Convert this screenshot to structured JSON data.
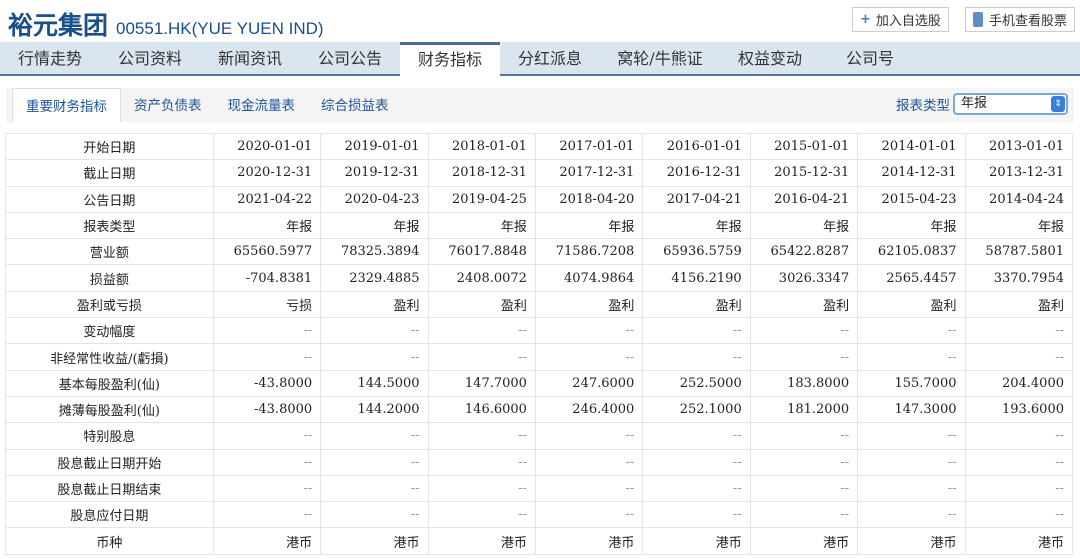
{
  "header": {
    "name": "裕元集团",
    "code": "00551.HK(YUE YUEN IND)",
    "add_watch": "加入自选股",
    "mobile_view": "手机查看股票"
  },
  "nav": [
    "行情走势",
    "公司资料",
    "新闻资讯",
    "公司公告",
    "财务指标",
    "分红派息",
    "窝轮/牛熊证",
    "权益变动",
    "公司号"
  ],
  "nav_active": 4,
  "subtabs": [
    "重要财务指标",
    "资产负债表",
    "现金流量表",
    "综合损益表"
  ],
  "report_type": {
    "label": "报表类型",
    "value": "年报"
  },
  "table": [
    [
      "开始日期",
      "2020-01-01",
      "2019-01-01",
      "2018-01-01",
      "2017-01-01",
      "2016-01-01",
      "2015-01-01",
      "2014-01-01",
      "2013-01-01"
    ],
    [
      "截止日期",
      "2020-12-31",
      "2019-12-31",
      "2018-12-31",
      "2017-12-31",
      "2016-12-31",
      "2015-12-31",
      "2014-12-31",
      "2013-12-31"
    ],
    [
      "公告日期",
      "2021-04-22",
      "2020-04-23",
      "2019-04-25",
      "2018-04-20",
      "2017-04-21",
      "2016-04-21",
      "2015-04-23",
      "2014-04-24"
    ],
    [
      "报表类型",
      "年报",
      "年报",
      "年报",
      "年报",
      "年报",
      "年报",
      "年报",
      "年报"
    ],
    [
      "营业额",
      "65560.5977",
      "78325.3894",
      "76017.8848",
      "71586.7208",
      "65936.5759",
      "65422.8287",
      "62105.0837",
      "58787.5801"
    ],
    [
      "损益额",
      "-704.8381",
      "2329.4885",
      "2408.0072",
      "4074.9864",
      "4156.2190",
      "3026.3347",
      "2565.4457",
      "3370.7954"
    ],
    [
      "盈利或亏损",
      "亏损",
      "盈利",
      "盈利",
      "盈利",
      "盈利",
      "盈利",
      "盈利",
      "盈利"
    ],
    [
      "变动幅度",
      "--",
      "--",
      "--",
      "--",
      "--",
      "--",
      "--",
      "--"
    ],
    [
      "非经常性收益/(虧損)",
      "--",
      "--",
      "--",
      "--",
      "--",
      "--",
      "--",
      "--"
    ],
    [
      "基本每股盈利(仙)",
      "-43.8000",
      "144.5000",
      "147.7000",
      "247.6000",
      "252.5000",
      "183.8000",
      "155.7000",
      "204.4000"
    ],
    [
      "摊薄每股盈利(仙)",
      "-43.8000",
      "144.2000",
      "146.6000",
      "246.4000",
      "252.1000",
      "181.2000",
      "147.3000",
      "193.6000"
    ],
    [
      "特别股息",
      "--",
      "--",
      "--",
      "--",
      "--",
      "--",
      "--",
      "--"
    ],
    [
      "股息截止日期开始",
      "--",
      "--",
      "--",
      "--",
      "--",
      "--",
      "--",
      "--"
    ],
    [
      "股息截止日期结束",
      "--",
      "--",
      "--",
      "--",
      "--",
      "--",
      "--",
      "--"
    ],
    [
      "股息应付日期",
      "--",
      "--",
      "--",
      "--",
      "--",
      "--",
      "--",
      "--"
    ],
    [
      "币种",
      "港币",
      "港币",
      "港币",
      "港币",
      "港币",
      "港币",
      "港币",
      "港币"
    ]
  ]
}
